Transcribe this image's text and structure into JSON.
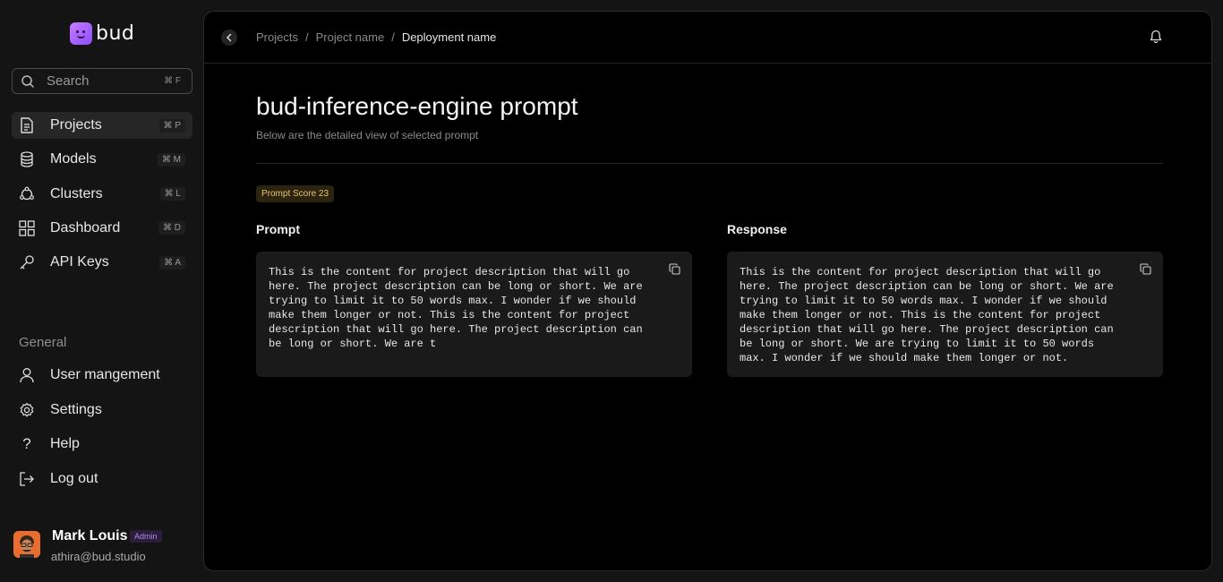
{
  "brand": {
    "name": "bud"
  },
  "search": {
    "placeholder": "Search",
    "shortcut": "⌘ F"
  },
  "nav": {
    "items": [
      {
        "label": "Projects",
        "shortcut": "⌘ P",
        "icon": "file-icon",
        "active": true
      },
      {
        "label": "Models",
        "shortcut": "⌘ M",
        "icon": "database-icon"
      },
      {
        "label": "Clusters",
        "shortcut": "⌘ L",
        "icon": "cluster-icon"
      },
      {
        "label": "Dashboard",
        "shortcut": "⌘ D",
        "icon": "grid-icon"
      },
      {
        "label": "API Keys",
        "shortcut": "⌘ A",
        "icon": "key-icon"
      }
    ]
  },
  "general": {
    "title": "General",
    "items": [
      {
        "label": "User mangement",
        "icon": "user-icon"
      },
      {
        "label": "Settings",
        "icon": "gear-icon"
      },
      {
        "label": "Help",
        "icon": "question-icon"
      },
      {
        "label": "Log out",
        "icon": "logout-icon"
      }
    ]
  },
  "user": {
    "name": "Mark Louis",
    "role": "Admin",
    "email": "athira@bud.studio"
  },
  "breadcrumb": {
    "items": [
      "Projects",
      "Project name"
    ],
    "current": "Deployment name"
  },
  "page": {
    "title": "bud-inference-engine prompt",
    "subtitle": "Below are the detailed view of selected prompt",
    "score": "Prompt Score 23"
  },
  "prompt": {
    "title": "Prompt",
    "text": "This is the content for project description that will go here. The project description can be long or short. We are trying to limit it to 50 words max. I wonder if we should make them longer or not. This is the content for project description that will go here. The project description can be long or short. We are t"
  },
  "response": {
    "title": "Response",
    "text": "This is the content for project description that will go here. The project description can be long or short. We are trying to limit it to 50 words max. I wonder if we should make them longer or not. This is the content for project description that will go here. The project description can be long or short. We are trying to limit it to 50 words max. I wonder if we should make them longer or not."
  },
  "colors": {
    "accent": "#8a4dff",
    "score_text": "#e8c46a",
    "admin_badge": "#b48ae6"
  }
}
